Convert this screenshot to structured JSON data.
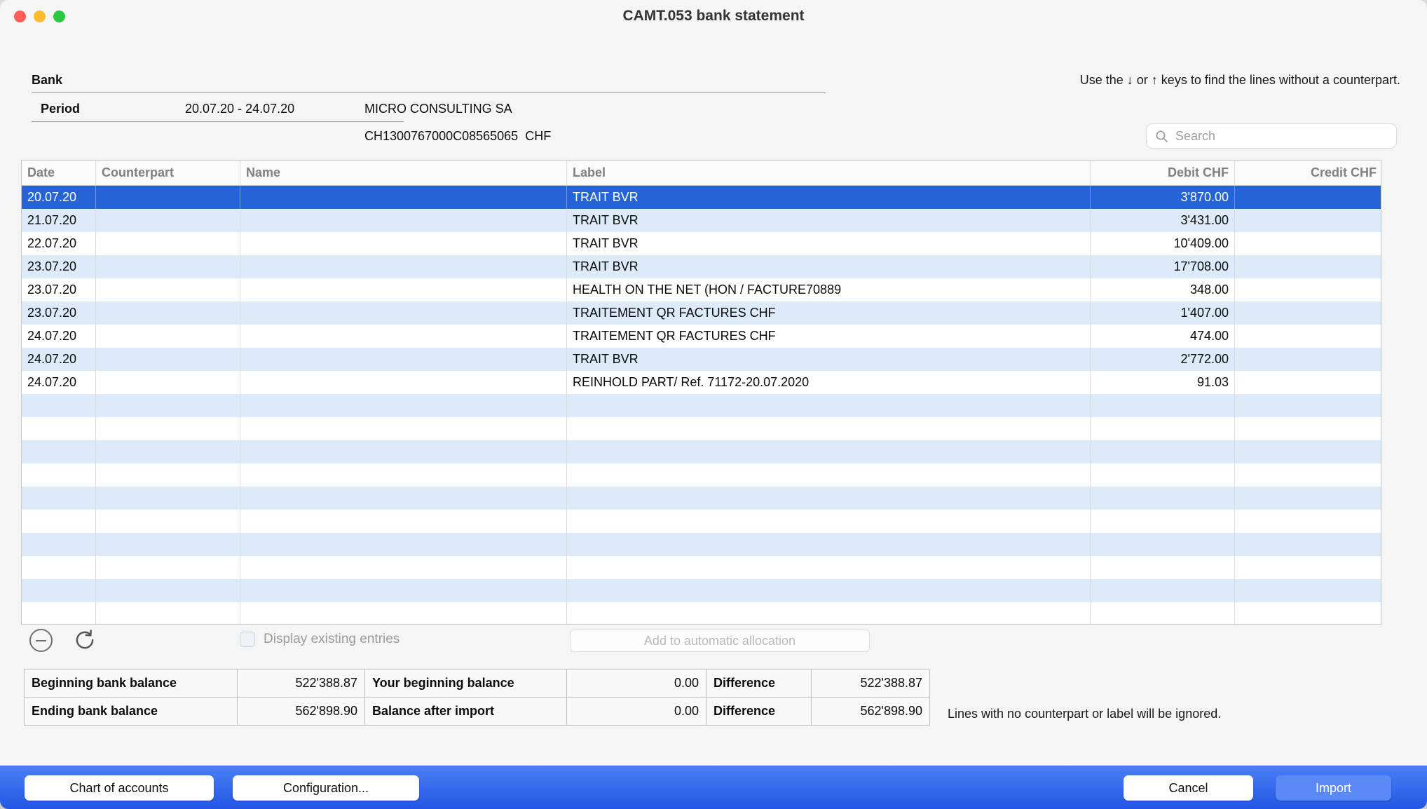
{
  "window": {
    "title": "CAMT.053 bank statement"
  },
  "header": {
    "bank_label": "Bank",
    "period_label": "Period",
    "period_value": "20.07.20 - 24.07.20",
    "account_name": "MICRO CONSULTING SA",
    "account_number": "CH1300767000C08565065  CHF",
    "hint": "Use the ↓ or ↑ keys to find the lines without a counterpart.",
    "search_placeholder": "Search"
  },
  "table": {
    "columns": [
      "Date",
      "Counterpart",
      "Name",
      "Label",
      "Debit CHF",
      "Credit CHF"
    ],
    "rows": [
      {
        "date": "20.07.20",
        "counterpart": "",
        "name": "",
        "label": "TRAIT BVR",
        "debit": "3'870.00",
        "credit": "",
        "selected": true
      },
      {
        "date": "21.07.20",
        "counterpart": "",
        "name": "",
        "label": "TRAIT BVR",
        "debit": "3'431.00",
        "credit": ""
      },
      {
        "date": "22.07.20",
        "counterpart": "",
        "name": "",
        "label": "TRAIT BVR",
        "debit": "10'409.00",
        "credit": ""
      },
      {
        "date": "23.07.20",
        "counterpart": "",
        "name": "",
        "label": "TRAIT BVR",
        "debit": "17'708.00",
        "credit": ""
      },
      {
        "date": "23.07.20",
        "counterpart": "",
        "name": "",
        "label": "HEALTH ON THE NET (HON / FACTURE70889",
        "debit": "348.00",
        "credit": ""
      },
      {
        "date": "23.07.20",
        "counterpart": "",
        "name": "",
        "label": "TRAITEMENT QR FACTURES CHF",
        "debit": "1'407.00",
        "credit": ""
      },
      {
        "date": "24.07.20",
        "counterpart": "",
        "name": "",
        "label": "TRAITEMENT QR FACTURES CHF",
        "debit": "474.00",
        "credit": ""
      },
      {
        "date": "24.07.20",
        "counterpart": "",
        "name": "",
        "label": "TRAIT BVR",
        "debit": "2'772.00",
        "credit": ""
      },
      {
        "date": "24.07.20",
        "counterpart": "",
        "name": "",
        "label": "REINHOLD PART/ Ref. 71172-20.07.2020",
        "debit": "91.03",
        "credit": ""
      }
    ],
    "empty_rows": 10
  },
  "controls": {
    "display_existing_label": "Display existing entries",
    "add_allocation_label": "Add to automatic allocation"
  },
  "summary": {
    "rows": [
      [
        {
          "label": "Beginning bank balance",
          "value": "522'388.87"
        },
        {
          "label": "Your beginning balance",
          "value": "0.00"
        },
        {
          "label": "Difference",
          "value": "522'388.87"
        }
      ],
      [
        {
          "label": "Ending bank balance",
          "value": "562'898.90"
        },
        {
          "label": "Balance after import",
          "value": "0.00"
        },
        {
          "label": "Difference",
          "value": "562'898.90"
        }
      ]
    ],
    "note": "Lines with no counterpart or label will be ignored."
  },
  "footer": {
    "chart_of_accounts": "Chart of accounts",
    "configuration": "Configuration...",
    "cancel": "Cancel",
    "import": "Import"
  },
  "colors": {
    "selection_blue": "#2564d6",
    "row_stripe": "#ddeafa",
    "footer_gradient_top": "#4b81f4",
    "footer_gradient_bottom": "#2356e4",
    "import_button": "#5b8af6",
    "traffic_red": "#ff5f57",
    "traffic_yellow": "#febc2e",
    "traffic_green": "#28c840"
  }
}
